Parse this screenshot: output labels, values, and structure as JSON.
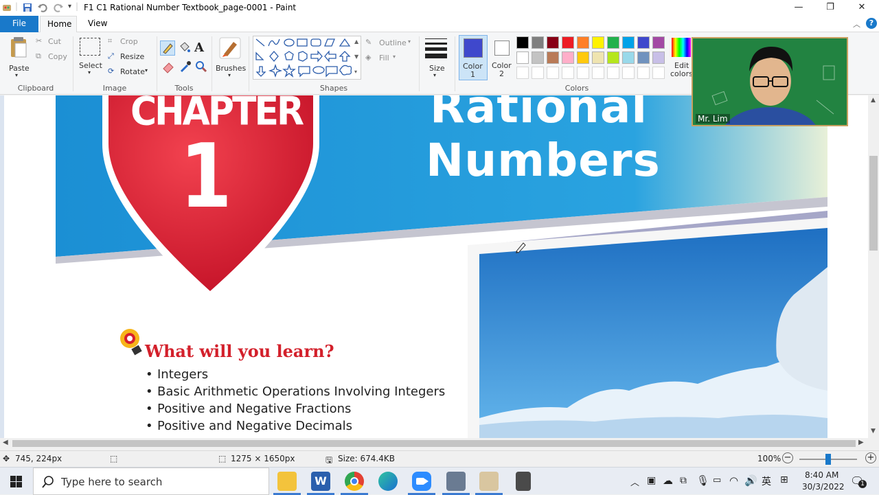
{
  "window": {
    "title": "F1 C1 Rational Number Textbook_page-0001 - Paint",
    "minimize_icon": "minimize-icon",
    "maximize_icon": "maximize-icon",
    "close_icon": "close-icon"
  },
  "tabs": {
    "file": "File",
    "home": "Home",
    "view": "View"
  },
  "ribbon": {
    "clipboard": {
      "paste": "Paste",
      "cut": "Cut",
      "copy": "Copy",
      "label": "Clipboard"
    },
    "image": {
      "select": "Select",
      "crop": "Crop",
      "resize": "Resize",
      "rotate": "Rotate",
      "label": "Image"
    },
    "tools": {
      "label": "Tools"
    },
    "brushes": {
      "label": "Brushes"
    },
    "shapes": {
      "outline": "Outline",
      "fill": "Fill",
      "label": "Shapes"
    },
    "size": {
      "label": "Size"
    },
    "colors": {
      "color1": "Color",
      "color1_num": "1",
      "color2": "Color",
      "color2_num": "2",
      "edit": "Edit",
      "edit2": "colors",
      "label": "Colors",
      "color1_value": "#3f48cc",
      "color2_value": "#ffffff",
      "palette_row1": [
        "#000000",
        "#7f7f7f",
        "#880015",
        "#ed1c24",
        "#ff7f27",
        "#fff200",
        "#22b14c",
        "#00a2e8",
        "#3f48cc",
        "#a349a4"
      ],
      "palette_row2": [
        "#ffffff",
        "#c3c3c3",
        "#b97a57",
        "#ffaec9",
        "#ffc90e",
        "#efe4b0",
        "#b5e61d",
        "#99d9ea",
        "#7092be",
        "#c8bfe7"
      ]
    }
  },
  "page": {
    "chapter_word": "CHAPTER",
    "chapter_number": "1",
    "title_line1": "Rational",
    "title_line2": "Numbers",
    "learn_heading": "What will you learn?",
    "topics": [
      "Integers",
      "Basic Arithmetic Operations Involving Integers",
      "Positive and Negative Fractions",
      "Positive and Negative Decimals"
    ]
  },
  "video": {
    "name": "Mr. Lim"
  },
  "status": {
    "cursor_pos": "745, 224px",
    "image_size": "1275 × 1650px",
    "file_size": "Size: 674.4KB",
    "zoom": "100%"
  },
  "taskbar": {
    "search_placeholder": "Type here to search",
    "time": "8:40 AM",
    "date": "30/3/2022",
    "lang": "英",
    "notification_count": "1"
  }
}
